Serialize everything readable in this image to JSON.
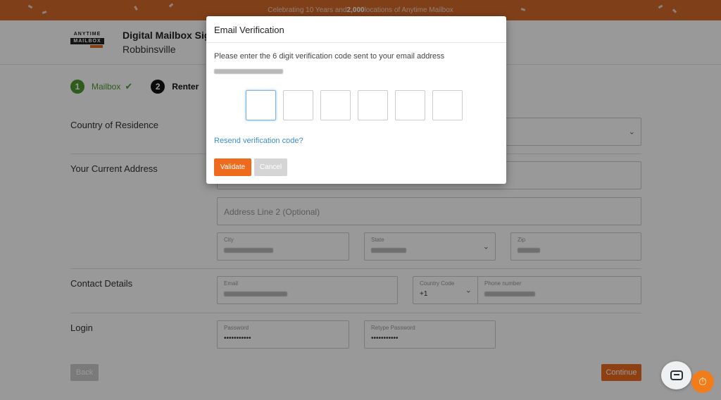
{
  "banner": {
    "text_pre": "Celebrating 10 Years and ",
    "text_bold": "2,000",
    "text_post": " locations of Anytime Mailbox"
  },
  "header": {
    "logo_line1": "ANYTIME",
    "logo_line2": "MAILBOX",
    "title": "Digital Mailbox Signup",
    "subtitle": "Robbinsville"
  },
  "steps": [
    {
      "number": "1",
      "label": "Mailbox"
    },
    {
      "number": "2",
      "label": "Renter"
    }
  ],
  "form": {
    "country_label": "Country of Residence",
    "address_label": "Your Current Address",
    "address_line2_placeholder": "Address Line 2 (Optional)",
    "city_label": "City",
    "state_label": "State",
    "zip_label": "Zip",
    "contact_label": "Contact Details",
    "email_label": "Email",
    "country_code_label": "Country Code",
    "country_code_value": "+1",
    "phone_label": "Phone number",
    "login_label": "Login",
    "password_label": "Password",
    "password_value": "•••••••••••",
    "retype_label": "Retype Password",
    "retype_value": "•••••••••••"
  },
  "buttons": {
    "back": "Back",
    "continue": "Continue"
  },
  "modal": {
    "title": "Email Verification",
    "instruction": "Please enter the 6 digit verification code sent to your email address",
    "resend": "Resend verification code?",
    "validate": "Validate",
    "cancel": "Cancel"
  },
  "colors": {
    "accent": "#ee6b1e",
    "banner": "#d4692a",
    "step_done": "#4f9a2f",
    "link": "#3b8fd0"
  },
  "icons": {
    "step_check": "check-icon",
    "dropdown": "chevron-down-icon",
    "chat": "chat-icon",
    "badge": "timer-check-icon"
  }
}
